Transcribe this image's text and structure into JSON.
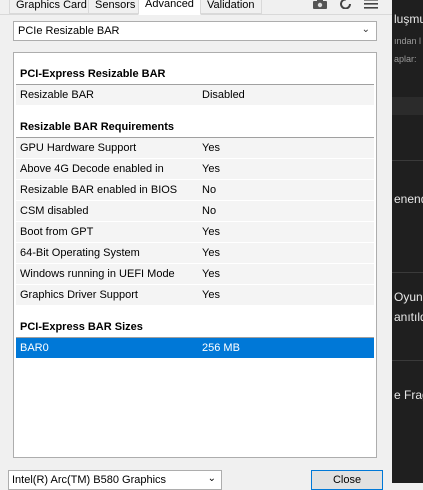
{
  "tabs": [
    {
      "label": "Graphics Card"
    },
    {
      "label": "Sensors"
    },
    {
      "label": "Advanced"
    },
    {
      "label": "Validation"
    }
  ],
  "category_select": {
    "value": "PCIe Resizable BAR"
  },
  "sections": {
    "pcie": {
      "title": "PCI-Express Resizable BAR",
      "rows": [
        {
          "key": "Resizable BAR",
          "value": "Disabled"
        }
      ]
    },
    "requirements": {
      "title": "Resizable BAR Requirements",
      "rows": [
        {
          "key": "GPU Hardware Support",
          "value": "Yes"
        },
        {
          "key": "Above 4G Decode enabled in",
          "value": "Yes"
        },
        {
          "key": "Resizable BAR enabled in BIOS",
          "value": "No"
        },
        {
          "key": "CSM disabled",
          "value": "No"
        },
        {
          "key": "Boot from GPT",
          "value": "Yes"
        },
        {
          "key": "64-Bit Operating System",
          "value": "Yes"
        },
        {
          "key": "Windows running in UEFI Mode",
          "value": "Yes"
        },
        {
          "key": "Graphics Driver Support",
          "value": "Yes"
        }
      ]
    },
    "sizes": {
      "title": "PCI-Express BAR Sizes",
      "rows": [
        {
          "key": "BAR0",
          "value": "256 MB"
        }
      ]
    }
  },
  "footer": {
    "gpu_select": "Intel(R) Arc(TM) B580 Graphics",
    "close_label": "Close"
  },
  "background_app": {
    "lines": [
      "luşmu",
      "ından l",
      "aplar:",
      "enend",
      "Oyun",
      "anıtıld",
      "e Frag"
    ]
  },
  "colors": {
    "selection": "#0078d7",
    "window_bg": "#f0f0f0"
  }
}
